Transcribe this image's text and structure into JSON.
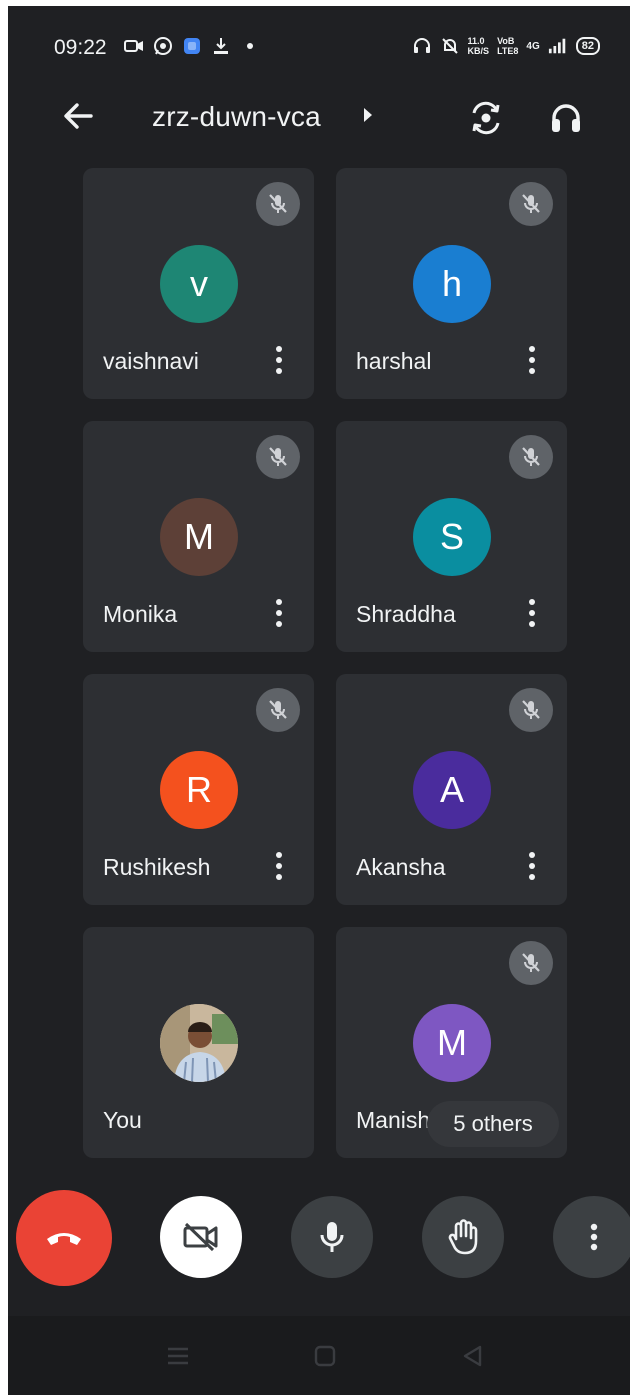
{
  "status_bar": {
    "time": "09:22",
    "net_speed_top": "11.0",
    "net_speed_bottom": "KB/S",
    "volte_top": "VoB",
    "volte_bottom": "LTE8",
    "network": "4G",
    "battery": "82"
  },
  "header": {
    "meeting_code": "zrz-duwn-vca"
  },
  "participants": [
    {
      "name": "vaishnavi",
      "initial": "v",
      "avatar_color": "#1e8674",
      "muted": true
    },
    {
      "name": "harshal",
      "initial": "h",
      "avatar_color": "#1a7ed1",
      "muted": true
    },
    {
      "name": "Monika",
      "initial": "M",
      "avatar_color": "#5d4037",
      "muted": true
    },
    {
      "name": "Shraddha",
      "initial": "S",
      "avatar_color": "#0a8ea0",
      "muted": true
    },
    {
      "name": "Rushikesh",
      "initial": "R",
      "avatar_color": "#f4511e",
      "muted": true
    },
    {
      "name": "Akansha",
      "initial": "A",
      "avatar_color": "#4a2c9d",
      "muted": true
    },
    {
      "name": "You",
      "initial": "",
      "avatar_color": "#b9a890",
      "muted": false
    },
    {
      "name": "Manisha",
      "initial": "M",
      "avatar_color": "#7e57c2",
      "muted": true
    }
  ],
  "others_chip": "5 others",
  "colors": {
    "background": "#1f2023",
    "tile": "#2d2f33",
    "end_call": "#ea4335",
    "control": "#3c4043"
  },
  "icons": {
    "back": "arrow-left-icon",
    "switch_camera": "switch-camera-icon",
    "audio_output": "headphones-icon",
    "muted": "mic-off-icon",
    "end_call": "phone-hangup-icon",
    "camera": "video-off-icon",
    "mic": "mic-icon",
    "raise_hand": "hand-icon",
    "more": "more-vert-icon"
  }
}
